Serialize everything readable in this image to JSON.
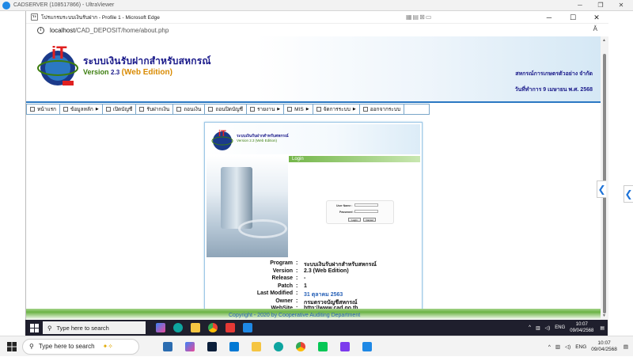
{
  "ultraviewer": {
    "title": "CADSERVER (108517866) - UltraViewer",
    "minimize": "─",
    "restore": "❐",
    "close": "✕"
  },
  "edge": {
    "window_title": "โปรแกรมระบบเงินรับฝาก - Profile 1 - Microsoft Edge",
    "favicon": "ระ",
    "minimize": "─",
    "maximize": "☐",
    "close": "✕",
    "tools": "▦▤⊠▭",
    "address_host": "localhost",
    "address_path": "/CAD_DEPOSIT/home/about.php",
    "read_aloud": "Ă",
    "info": "i"
  },
  "banner": {
    "system_name": "ระบบเงินรับฝากสำหรับสหกรณ์",
    "version_label": "Version",
    "version_number": "2.3",
    "edition": "(Web Edition)",
    "organization": "สหกรณ์การเกษตรตัวอย่าง จำกัด",
    "date": "วันที่ทำการ 9 เมษายน พ.ศ. 2568"
  },
  "menu": [
    {
      "label": "หน้าแรก",
      "arrow": false
    },
    {
      "label": "ข้อมูลหลัก",
      "arrow": true
    },
    {
      "label": "เปิดบัญชี",
      "arrow": false
    },
    {
      "label": "รับฝากเงิน",
      "arrow": false
    },
    {
      "label": "ถอนเงิน",
      "arrow": false
    },
    {
      "label": "ถอนปิดบัญชี",
      "arrow": false
    },
    {
      "label": "รายงาน",
      "arrow": true
    },
    {
      "label": "MIS",
      "arrow": true
    },
    {
      "label": "จัดการระบบ",
      "arrow": true
    },
    {
      "label": "ออกจากระบบ",
      "arrow": false
    }
  ],
  "about": {
    "mini_name": "ระบบเงินรับฝากสำหรับสหกรณ์",
    "mini_version": "Version 2.3 (Web Edition)",
    "login_bar": "Login",
    "username_label": "User Name :",
    "password_label": "Password :",
    "login_button": "Login",
    "cancel_button": "Cancel",
    "rows": [
      {
        "key": "Program",
        "value": "ระบบเงินรับฝากสำหรับสหกรณ์",
        "blue": false
      },
      {
        "key": "Version",
        "value": "2.3 (Web Edition)",
        "blue": false
      },
      {
        "key": "Release",
        "value": "-",
        "blue": false
      },
      {
        "key": "Patch",
        "value": "1",
        "blue": false
      },
      {
        "key": "Last Modified",
        "value": "31 ตุลาคม 2563",
        "blue": true
      },
      {
        "key": "Owner",
        "value": "กรมตรวจบัญชีสหกรณ์",
        "blue": false
      },
      {
        "key": "WebSite",
        "value": "http://www.cad.go.th",
        "blue": false
      }
    ],
    "colon": ":"
  },
  "footer": {
    "copyright": "Copyright - 2020 by Cooperative Auditing Department"
  },
  "inner_taskbar": {
    "search_placeholder": "Type here to search",
    "lang": "ENG",
    "time": "10:07",
    "date": "09/04/2568"
  },
  "outer_taskbar": {
    "search_placeholder": "Type here to search",
    "lang": "ENG",
    "time": "10:07",
    "date": "09/04/2568"
  },
  "side_tab_arrow": "❮",
  "colors": {
    "brand_blue": "#1a1a8a",
    "brand_green": "#3c7d0e",
    "link_blue": "#2a63b8",
    "login_green": "#74b64a"
  }
}
